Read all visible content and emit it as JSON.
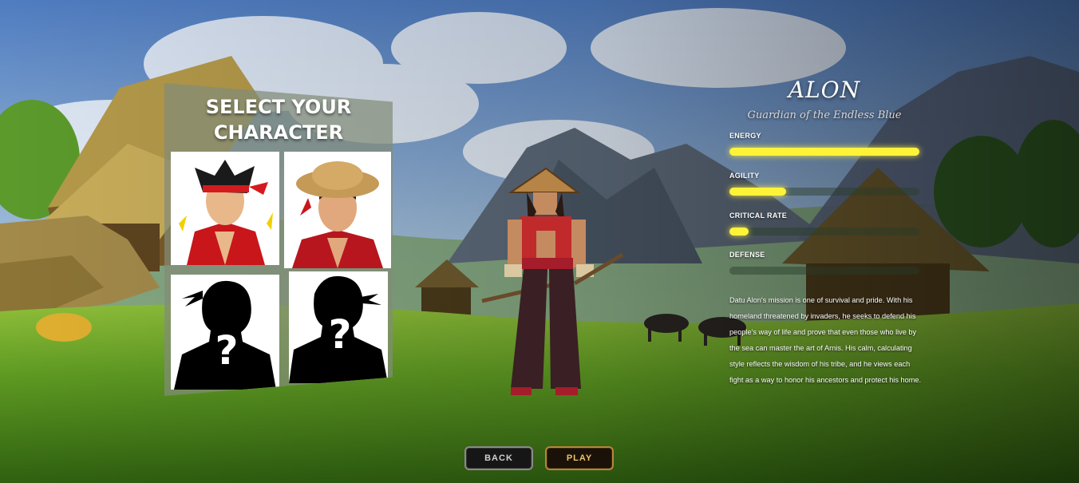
{
  "select_panel": {
    "title_line1": "SELECT YOUR",
    "title_line2": "CHARACTER"
  },
  "characters": [
    {
      "name": "red-bandana-fighter",
      "locked": false
    },
    {
      "name": "straw-hat-fighter",
      "locked": false
    },
    {
      "name": "locked-character-1",
      "locked": true,
      "mark": "?"
    },
    {
      "name": "locked-character-2",
      "locked": true,
      "mark": "?"
    }
  ],
  "hero": {
    "name": "ALON",
    "title": "Guardian of the Endless Blue",
    "stats": [
      {
        "label": "ENERGY",
        "value": 1.0
      },
      {
        "label": "AGILITY",
        "value": 0.3
      },
      {
        "label": "CRITICAL RATE",
        "value": 0.1
      },
      {
        "label": "DEFENSE",
        "value": 0.0
      }
    ],
    "description": "Datu Alon's mission is one of survival and pride. With his homeland threatened by invaders, he seeks to defend his people's way of life and prove that even those who live by the sea can master the art of Arnis. His calm, calculating style reflects the wisdom of his tribe, and he views each fight as a way to honor his ancestors and protect his home."
  },
  "buttons": {
    "back": "BACK",
    "play": "PLAY"
  },
  "colors": {
    "stat_fill": "#fff33a",
    "play_border": "#b8853a",
    "back_border": "#8a8a8a"
  }
}
